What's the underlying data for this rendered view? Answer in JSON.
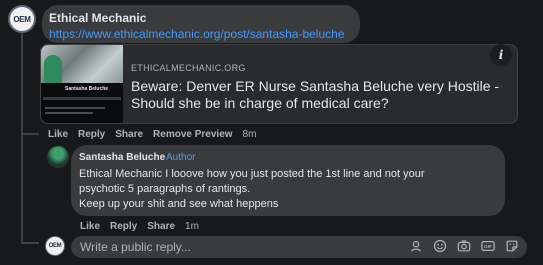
{
  "post": {
    "author": "Ethical Mechanic",
    "url": "https://www.ethicalmechanic.org/post/santasha-beluche",
    "avatar_text": "OEM"
  },
  "link_preview": {
    "domain": "ETHICALMECHANIC.ORG",
    "title": "Beware: Denver ER Nurse Santasha Beluche very Hostile - Should she be in charge of medical care?",
    "thumbnail_name": "Santasha Beluche",
    "info_label": "i"
  },
  "post_actions": {
    "like": "Like",
    "reply": "Reply",
    "share": "Share",
    "remove_preview": "Remove Preview",
    "time": "8m"
  },
  "reply_comment": {
    "author": "Santasha Beluche",
    "badge": "Author",
    "lines": [
      "Ethical Mechanic I looove how you just posted the 1st line and not your",
      "psychotic 5 paragraphs of rantings.",
      "Keep up your shit and see what heppens"
    ]
  },
  "reply_actions": {
    "like": "Like",
    "reply": "Reply",
    "share": "Share",
    "time": "1m"
  },
  "composer": {
    "placeholder": "Write a public reply...",
    "avatar_text": "OEM",
    "icons": [
      "avatar-sticker-icon",
      "emoji-icon",
      "camera-icon",
      "gif-icon",
      "sticker-icon"
    ]
  },
  "colors": {
    "background": "#18191a",
    "bubble": "#3a3b3c",
    "link": "#4599ff",
    "secondary_text": "#b0b3b8"
  }
}
